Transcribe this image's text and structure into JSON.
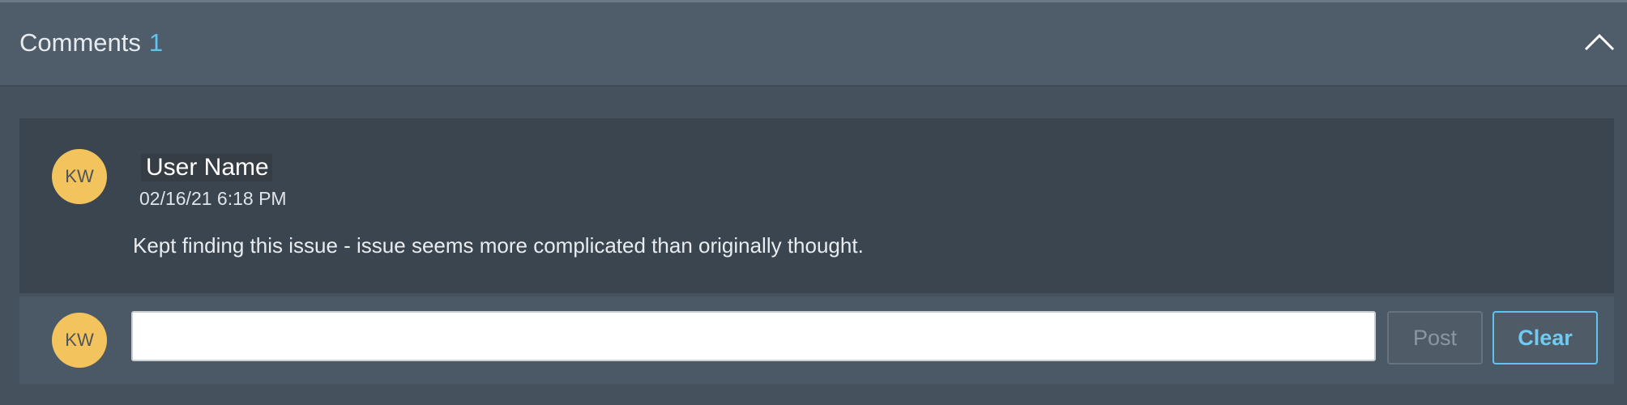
{
  "header": {
    "title": "Comments",
    "count": "1",
    "collapse_icon": "chevron-up-icon"
  },
  "comment": {
    "avatar_initials": "KW",
    "user_name": "User Name",
    "timestamp": "02/16/21 6:18 PM",
    "text": "Kept finding this issue - issue seems more complicated than originally thought."
  },
  "compose": {
    "avatar_initials": "KW",
    "input_value": "",
    "post_label": "Post",
    "clear_label": "Clear"
  },
  "colors": {
    "accent": "#5fc3ee",
    "avatar": "#f3c45e",
    "header_bg": "#4f5c69",
    "card_bg": "#3b4550"
  }
}
